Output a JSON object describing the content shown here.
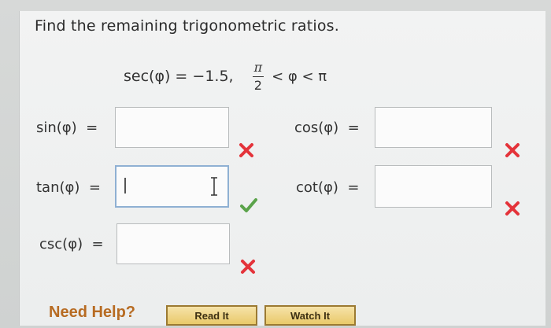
{
  "question": {
    "prompt": "Find the remaining trigonometric ratios.",
    "given_sec": "sec(φ) = −1.5,",
    "interval_numerator": "π",
    "interval_denominator": "2",
    "interval_rest": "< φ < π"
  },
  "answers": [
    {
      "label": "sin(φ)  =",
      "value": "",
      "status": "incorrect"
    },
    {
      "label": "cos(φ)  =",
      "value": "",
      "status": "incorrect"
    },
    {
      "label": "tan(φ)  =",
      "value": "",
      "status": "correct"
    },
    {
      "label": "cot(φ)  =",
      "value": "",
      "status": "incorrect"
    },
    {
      "label": "csc(φ)  =",
      "value": "",
      "status": "incorrect"
    }
  ],
  "help": {
    "title": "Need Help?",
    "read_label": "Read It",
    "watch_label": "Watch It"
  },
  "colors": {
    "incorrect": "#e4333a",
    "correct": "#5aa34a",
    "button_fill": "#ecd17c",
    "help_text": "#b76b22"
  }
}
